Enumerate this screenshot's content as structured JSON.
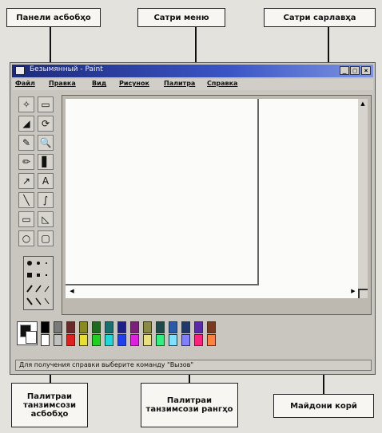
{
  "callouts": {
    "toolbox_panel": "Панели асбобҳо",
    "menu_bar": "Сатри меню",
    "title_bar": "Сатри сарлавҳа",
    "tool_palette": "Палитраи танзимсози асбобҳо",
    "color_palette": "Палитраи танзимсози рангҳо",
    "work_area": "Майдони корӣ"
  },
  "window": {
    "title": "Безымянный - Paint",
    "minimize": "_",
    "maximize": "□",
    "close": "×"
  },
  "menu": [
    "Файл",
    "Правка",
    "Вид",
    "Рисунок",
    "Палитра",
    "Справка"
  ],
  "tools": [
    "✧",
    "▭",
    "◢",
    "⟳",
    "✎",
    "🔍",
    "✏",
    "▋",
    "↗",
    "A",
    "╲",
    "∫",
    "▭",
    "◺",
    "○",
    "▢"
  ],
  "status": "Для получения справки выберите команду \"Вызов\"",
  "colors": {
    "top": [
      "#000000",
      "#7a7a7a",
      "#6b2a2a",
      "#8a8a20",
      "#1f6a1f",
      "#1a7070",
      "#1f1f8a",
      "#7a1f7a",
      "#8a8a45",
      "#1f4a4a",
      "#2a5aa8",
      "#1f3a6a",
      "#5a2aa8",
      "#7a3a1f"
    ],
    "bottom": [
      "#ffffff",
      "#c0c0c0",
      "#e02020",
      "#e8e030",
      "#20d020",
      "#20d8d8",
      "#2040f0",
      "#e020e0",
      "#e8e080",
      "#30f080",
      "#80e0ff",
      "#8080ff",
      "#ff2080",
      "#ff8040"
    ]
  }
}
